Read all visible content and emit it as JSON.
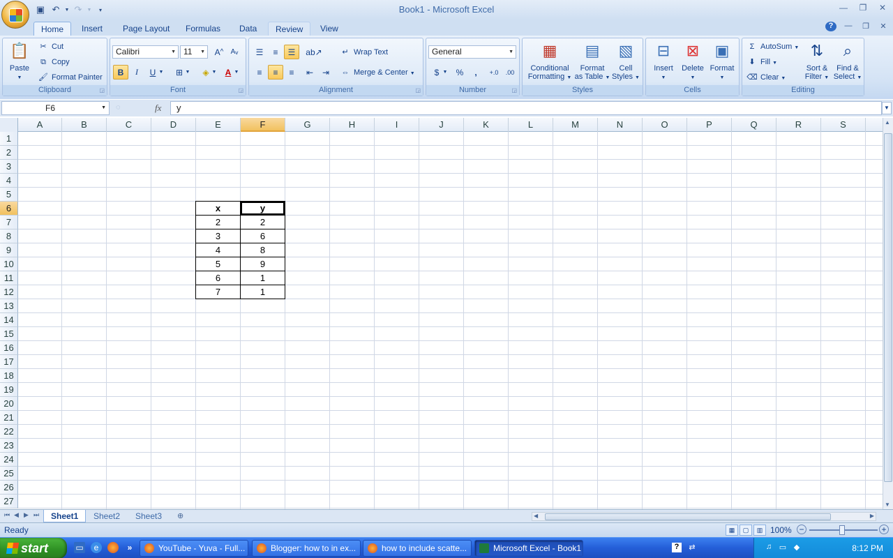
{
  "window": {
    "title": "Book1 - Microsoft Excel"
  },
  "ribbon_tabs": [
    "Home",
    "Insert",
    "Page Layout",
    "Formulas",
    "Data",
    "Review",
    "View"
  ],
  "clipboard": {
    "paste": "Paste",
    "cut": "Cut",
    "copy": "Copy",
    "format_painter": "Format Painter",
    "label": "Clipboard"
  },
  "font": {
    "name": "Calibri",
    "size": "11",
    "label": "Font",
    "bold": "B",
    "italic": "I",
    "underline": "U"
  },
  "alignment": {
    "wrap_text": "Wrap Text",
    "merge_center": "Merge & Center",
    "label": "Alignment"
  },
  "number": {
    "format": "General",
    "currency": "$",
    "percent": "%",
    "comma": ",",
    "label": "Number"
  },
  "styles": {
    "conditional_1": "Conditional",
    "conditional_2": "Formatting",
    "format_table_1": "Format",
    "format_table_2": "as Table",
    "cell_styles_1": "Cell",
    "cell_styles_2": "Styles",
    "label": "Styles"
  },
  "cells": {
    "insert": "Insert",
    "delete": "Delete",
    "format": "Format",
    "label": "Cells"
  },
  "editing": {
    "autosum": "AutoSum",
    "fill": "Fill",
    "clear": "Clear",
    "sort_1": "Sort &",
    "sort_2": "Filter",
    "find_1": "Find &",
    "find_2": "Select",
    "label": "Editing"
  },
  "formula_bar": {
    "name_box": "F6",
    "fx": "fx",
    "content": "y"
  },
  "columns": [
    "A",
    "B",
    "C",
    "D",
    "E",
    "F",
    "G",
    "H",
    "I",
    "J",
    "K",
    "L",
    "M",
    "N",
    "O",
    "P",
    "Q",
    "R",
    "S"
  ],
  "rows": [
    "1",
    "2",
    "3",
    "4",
    "5",
    "6",
    "7",
    "8",
    "9",
    "10",
    "11",
    "12",
    "13",
    "14",
    "15",
    "16",
    "17",
    "18",
    "19",
    "20",
    "21",
    "22",
    "23",
    "24",
    "25",
    "26",
    "27"
  ],
  "table": {
    "headers": [
      "x",
      "y"
    ],
    "rows": [
      [
        "2",
        "2"
      ],
      [
        "3",
        "6"
      ],
      [
        "4",
        "8"
      ],
      [
        "5",
        "9"
      ],
      [
        "6",
        "1"
      ],
      [
        "7",
        "1"
      ]
    ]
  },
  "sheets": [
    "Sheet1",
    "Sheet2",
    "Sheet3"
  ],
  "status": {
    "ready": "Ready",
    "zoom": "100%"
  },
  "taskbar": {
    "start": "start",
    "tasks": [
      "YouTube - Yuva - Full...",
      "Blogger: how to in ex...",
      "how to include scatte...",
      "Microsoft Excel - Book1"
    ],
    "clock": "8:12 PM"
  },
  "colors": {
    "accent": "#15428b",
    "selected_header": "#f1c15f",
    "taskbar": "#245ed8",
    "start": "#2d8f23"
  }
}
